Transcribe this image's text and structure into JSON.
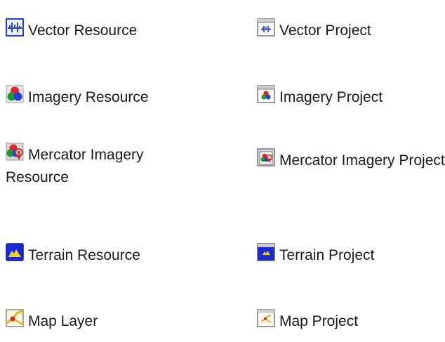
{
  "items": [
    {
      "label": "Vector Resource",
      "icon": "vector-resource-icon"
    },
    {
      "label": "Vector Project",
      "icon": "vector-project-icon"
    },
    {
      "label": "Imagery Resource",
      "icon": "imagery-resource-icon"
    },
    {
      "label": "Imagery Project",
      "icon": "imagery-project-icon"
    },
    {
      "label": "Mercator Imagery Resource",
      "icon": "mercator-imagery-resource-icon"
    },
    {
      "label": "Mercator Imagery Project",
      "icon": "mercator-imagery-project-icon"
    },
    {
      "label": "Terrain Resource",
      "icon": "terrain-resource-icon"
    },
    {
      "label": "Terrain Project",
      "icon": "terrain-project-icon"
    },
    {
      "label": "Map Layer",
      "icon": "map-layer-icon"
    },
    {
      "label": "Map Project",
      "icon": "map-project-icon"
    }
  ],
  "colors": {
    "vector_blue": "#1f3fd6",
    "terrain_blue": "#1a2ad8",
    "terrain_yellow": "#f4d21a",
    "red": "#e2242c",
    "green": "#1e9a2e",
    "blue": "#2440d8",
    "pin_red": "#c9302c"
  }
}
